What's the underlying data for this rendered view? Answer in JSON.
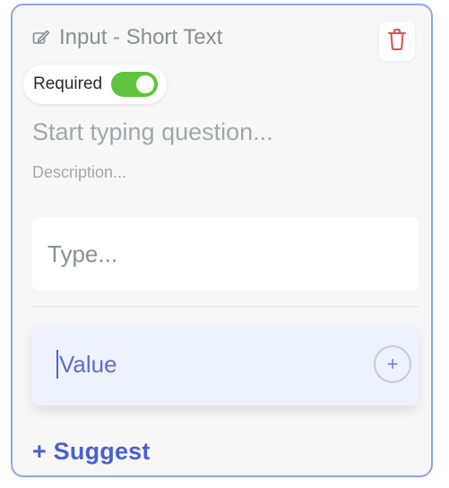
{
  "field": {
    "type_label": "Input - Short Text",
    "type_icon": "edit-icon",
    "delete_icon": "trash-icon",
    "required_label": "Required",
    "required_on": true,
    "question_placeholder": "Start typing question...",
    "description_placeholder": "Description...",
    "answer_placeholder": "Type...",
    "value_input": "Value",
    "add_icon": "plus-icon",
    "add_label": "+",
    "suggest_label": "+ Suggest"
  },
  "colors": {
    "border_accent": "#8fa5ea",
    "toggle_on": "#5fc43d",
    "delete_red": "#d9534f",
    "link_blue": "#4a5fd1",
    "value_bg": "#edf2fd"
  }
}
